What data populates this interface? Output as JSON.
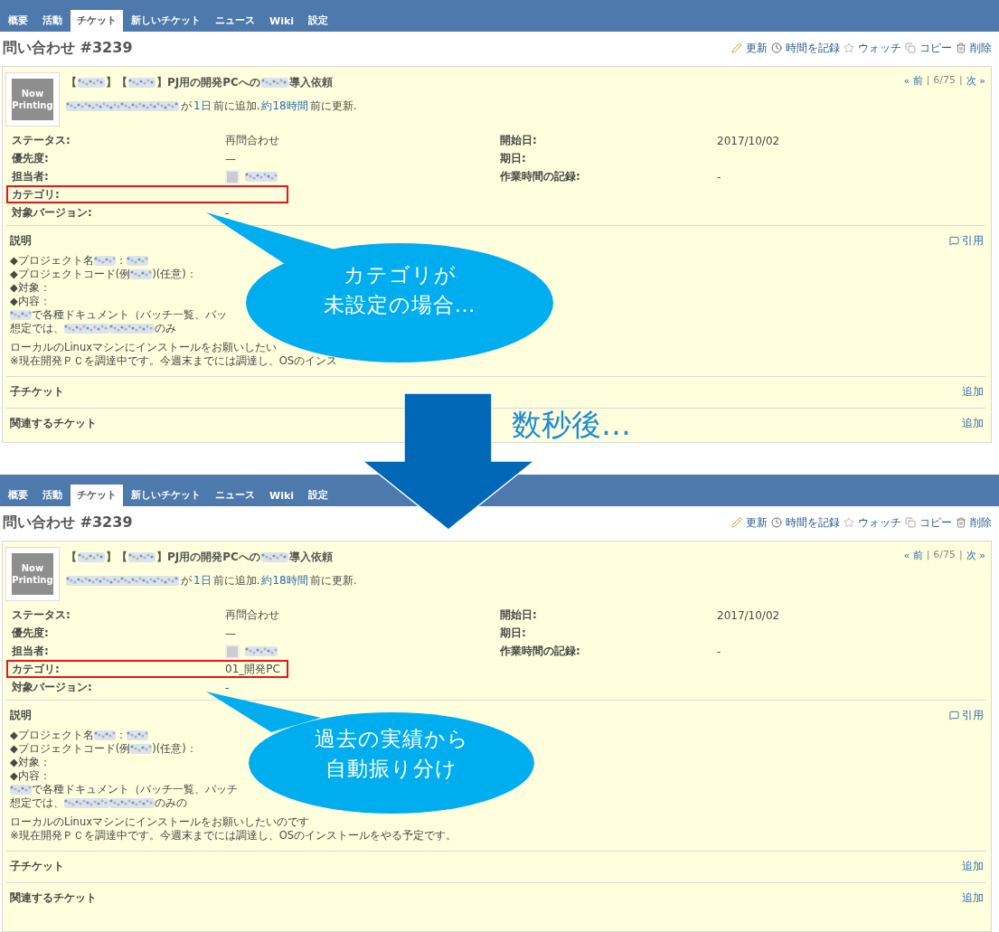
{
  "panels": [
    {
      "tabs": [
        {
          "label": "概要",
          "selected": false
        },
        {
          "label": "活動",
          "selected": false
        },
        {
          "label": "チケット",
          "selected": true
        },
        {
          "label": "新しいチケット",
          "selected": false
        },
        {
          "label": "ニュース",
          "selected": false
        },
        {
          "label": "Wiki",
          "selected": false
        },
        {
          "label": "設定",
          "selected": false
        }
      ],
      "heading": "問い合わせ #3239",
      "actions": [
        "更新",
        "時間を記録",
        "ウォッチ",
        "コピー",
        "削除"
      ],
      "avatar": "Now Printing",
      "subject": [
        {
          "kind": "text",
          "text": "【"
        },
        {
          "kind": "redacted"
        },
        {
          "kind": "text",
          "text": "】【"
        },
        {
          "kind": "redacted"
        },
        {
          "kind": "text",
          "text": "】PJ用の開発PCへの"
        },
        {
          "kind": "redacted"
        },
        {
          "kind": "text",
          "text": "導入依頼"
        }
      ],
      "byline": [
        {
          "kind": "redacted"
        },
        {
          "kind": "text",
          "text": "が"
        },
        {
          "kind": "link",
          "text": "1日"
        },
        {
          "kind": "text",
          "text": "前に追加."
        },
        {
          "kind": "link",
          "text": "約18時間"
        },
        {
          "kind": "text",
          "text": "前に更新."
        }
      ],
      "pager": [
        {
          "kind": "link",
          "text": "« 前"
        },
        {
          "kind": "text",
          "text": "|"
        },
        {
          "kind": "text",
          "text": "6/75"
        },
        {
          "kind": "text",
          "text": "|"
        },
        {
          "kind": "link",
          "text": "次 »"
        }
      ],
      "fields_left": [
        {
          "label": "ステータス:",
          "value": "再問合わせ",
          "highlighted": false
        },
        {
          "label": "優先度:",
          "value": "—",
          "highlighted": false
        },
        {
          "label": "担当者:",
          "value_segments": [
            {
              "kind": "avatar"
            },
            {
              "kind": "redacted"
            }
          ],
          "highlighted": false
        },
        {
          "label": "カテゴリ:",
          "highlighted": true
        },
        {
          "label": "対象バージョン:",
          "value": "-",
          "highlighted": false
        }
      ],
      "fields_right": [
        {
          "label": "開始日:",
          "value": "2017/10/02",
          "highlighted": false
        },
        {
          "label": "期日:",
          "highlighted": false
        },
        {
          "label": "作業時間の記録:",
          "value": "-",
          "highlighted": false
        }
      ],
      "description": {
        "title": "説明",
        "quote": "引用",
        "paragraphs": [
          [
            [
              {
                "kind": "text",
                "text": "◆プロジェクト名"
              },
              {
                "kind": "redacted"
              },
              {
                "kind": "text",
                "text": "："
              },
              {
                "kind": "redacted"
              }
            ],
            [
              {
                "kind": "text",
                "text": "◆プロジェクトコード(例"
              },
              {
                "kind": "redacted"
              },
              {
                "kind": "text",
                "text": ")(任意)："
              }
            ],
            [
              {
                "kind": "text",
                "text": "◆対象："
              }
            ],
            [
              {
                "kind": "text",
                "text": "◆内容："
              }
            ],
            [
              {
                "kind": "redacted"
              },
              {
                "kind": "text",
                "text": "で各種ドキュメント（バッチ一覧、バッ"
              }
            ],
            [
              {
                "kind": "text",
                "text": "想定では、"
              },
              {
                "kind": "redacted"
              },
              {
                "kind": "redacted"
              },
              {
                "kind": "text",
                "text": "のみ"
              }
            ]
          ],
          [
            [
              {
                "kind": "text",
                "text": "ローカルのLinuxマシンにインストールをお願いしたい"
              }
            ],
            [
              {
                "kind": "text",
                "text": "※現在開発ＰＣを調達中です。今週末までには調達し、OSのインス"
              }
            ]
          ]
        ]
      },
      "sections": [
        {
          "title": "子チケット",
          "action": "追加"
        },
        {
          "title": "関連するチケット",
          "action": "追加"
        }
      ]
    },
    {
      "tabs": [
        {
          "label": "概要",
          "selected": false
        },
        {
          "label": "活動",
          "selected": false
        },
        {
          "label": "チケット",
          "selected": true
        },
        {
          "label": "新しいチケット",
          "selected": false
        },
        {
          "label": "ニュース",
          "selected": false
        },
        {
          "label": "Wiki",
          "selected": false
        },
        {
          "label": "設定",
          "selected": false
        }
      ],
      "heading": "問い合わせ #3239",
      "actions": [
        "更新",
        "時間を記録",
        "ウォッチ",
        "コピー",
        "削除"
      ],
      "avatar": "Now Printing",
      "subject": [
        {
          "kind": "text",
          "text": "【"
        },
        {
          "kind": "redacted"
        },
        {
          "kind": "text",
          "text": "】【"
        },
        {
          "kind": "redacted"
        },
        {
          "kind": "text",
          "text": "】PJ用の開発PCへの"
        },
        {
          "kind": "redacted"
        },
        {
          "kind": "text",
          "text": "導入依頼"
        }
      ],
      "byline": [
        {
          "kind": "redacted"
        },
        {
          "kind": "text",
          "text": "が"
        },
        {
          "kind": "link",
          "text": "1日"
        },
        {
          "kind": "text",
          "text": "前に追加."
        },
        {
          "kind": "link",
          "text": "約18時間"
        },
        {
          "kind": "text",
          "text": "前に更新."
        }
      ],
      "pager": [
        {
          "kind": "link",
          "text": "« 前"
        },
        {
          "kind": "text",
          "text": "|"
        },
        {
          "kind": "text",
          "text": "6/75"
        },
        {
          "kind": "text",
          "text": "|"
        },
        {
          "kind": "link",
          "text": "次 »"
        }
      ],
      "fields_left": [
        {
          "label": "ステータス:",
          "value": "再問合わせ",
          "highlighted": false
        },
        {
          "label": "優先度:",
          "value": "—",
          "highlighted": false
        },
        {
          "label": "担当者:",
          "value_segments": [
            {
              "kind": "avatar"
            },
            {
              "kind": "redacted"
            }
          ],
          "highlighted": false
        },
        {
          "label": "カテゴリ:",
          "value": "01_開発PC",
          "highlighted": true
        },
        {
          "label": "対象バージョン:",
          "value": "-",
          "highlighted": false
        }
      ],
      "fields_right": [
        {
          "label": "開始日:",
          "value": "2017/10/02",
          "highlighted": false
        },
        {
          "label": "期日:",
          "highlighted": false
        },
        {
          "label": "作業時間の記録:",
          "value": "-",
          "highlighted": false
        }
      ],
      "description": {
        "title": "説明",
        "quote": "引用",
        "paragraphs": [
          [
            [
              {
                "kind": "text",
                "text": "◆プロジェクト名"
              },
              {
                "kind": "redacted"
              },
              {
                "kind": "text",
                "text": "："
              },
              {
                "kind": "redacted"
              }
            ],
            [
              {
                "kind": "text",
                "text": "◆プロジェクトコード(例"
              },
              {
                "kind": "redacted"
              },
              {
                "kind": "text",
                "text": ")(任意)："
              }
            ],
            [
              {
                "kind": "text",
                "text": "◆対象："
              }
            ],
            [
              {
                "kind": "text",
                "text": "◆内容："
              }
            ],
            [
              {
                "kind": "redacted"
              },
              {
                "kind": "text",
                "text": "で各種ドキュメント（バッチ一覧、バッチ"
              }
            ],
            [
              {
                "kind": "text",
                "text": "想定では、"
              },
              {
                "kind": "redacted"
              },
              {
                "kind": "redacted"
              },
              {
                "kind": "text",
                "text": "のみの"
              }
            ]
          ],
          [
            [
              {
                "kind": "text",
                "text": "ローカルのLinuxマシンにインストールをお願いしたいのです"
              }
            ],
            [
              {
                "kind": "text",
                "text": "※現在開発ＰＣを調達中です。今週末までには調達し、OSのインストールをやる予定です。"
              }
            ]
          ]
        ]
      },
      "sections": [
        {
          "title": "子チケット",
          "action": "追加"
        },
        {
          "title": "関連するチケット",
          "action": "追加"
        }
      ]
    }
  ],
  "callouts": [
    {
      "lines": [
        "カテゴリが",
        "未設定の場合…"
      ]
    },
    {
      "lines": [
        "過去の実績から",
        "自動振り分け"
      ]
    }
  ],
  "transition": {
    "caption": "数秒後…"
  }
}
